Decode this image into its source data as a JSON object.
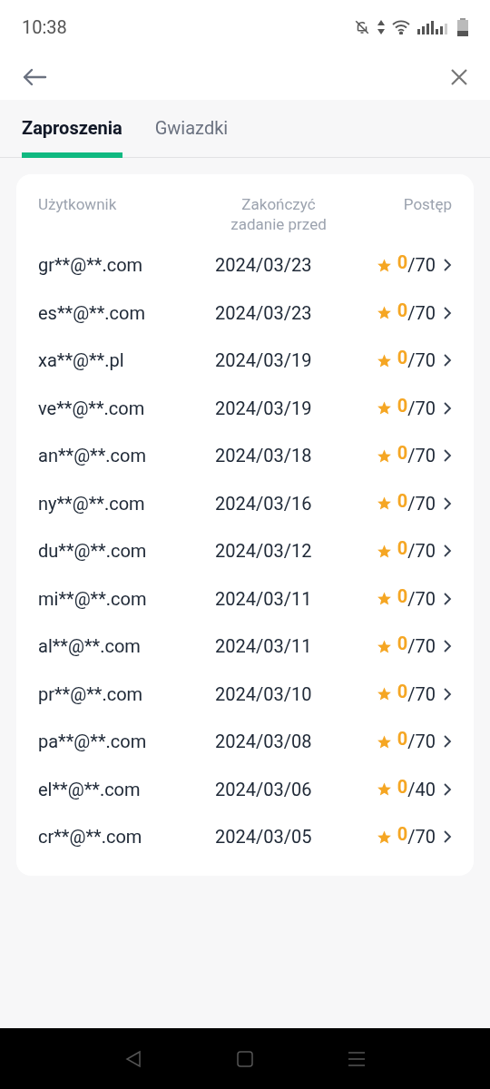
{
  "status_bar": {
    "time": "10:38"
  },
  "tabs": [
    {
      "label": "Zaproszenia",
      "selected": true
    },
    {
      "label": "Gwiazdki",
      "selected": false
    }
  ],
  "table": {
    "columns": [
      "Użytkownik",
      "Zakończyć zadanie przed",
      "Postęp"
    ],
    "rows": [
      {
        "user": "gr**@**.com",
        "date": "2024/03/23",
        "done": "0",
        "total": "/70"
      },
      {
        "user": "es**@**.com",
        "date": "2024/03/23",
        "done": "0",
        "total": "/70"
      },
      {
        "user": "xa**@**.pl",
        "date": "2024/03/19",
        "done": "0",
        "total": "/70"
      },
      {
        "user": "ve**@**.com",
        "date": "2024/03/19",
        "done": "0",
        "total": "/70"
      },
      {
        "user": "an**@**.com",
        "date": "2024/03/18",
        "done": "0",
        "total": "/70"
      },
      {
        "user": "ny**@**.com",
        "date": "2024/03/16",
        "done": "0",
        "total": "/70"
      },
      {
        "user": "du**@**.com",
        "date": "2024/03/12",
        "done": "0",
        "total": "/70"
      },
      {
        "user": "mi**@**.com",
        "date": "2024/03/11",
        "done": "0",
        "total": "/70"
      },
      {
        "user": "al**@**.com",
        "date": "2024/03/11",
        "done": "0",
        "total": "/70"
      },
      {
        "user": "pr**@**.com",
        "date": "2024/03/10",
        "done": "0",
        "total": "/70"
      },
      {
        "user": "pa**@**.com",
        "date": "2024/03/08",
        "done": "0",
        "total": "/70"
      },
      {
        "user": "el**@**.com",
        "date": "2024/03/06",
        "done": "0",
        "total": "/40"
      },
      {
        "user": "cr**@**.com",
        "date": "2024/03/05",
        "done": "0",
        "total": "/70"
      }
    ]
  }
}
